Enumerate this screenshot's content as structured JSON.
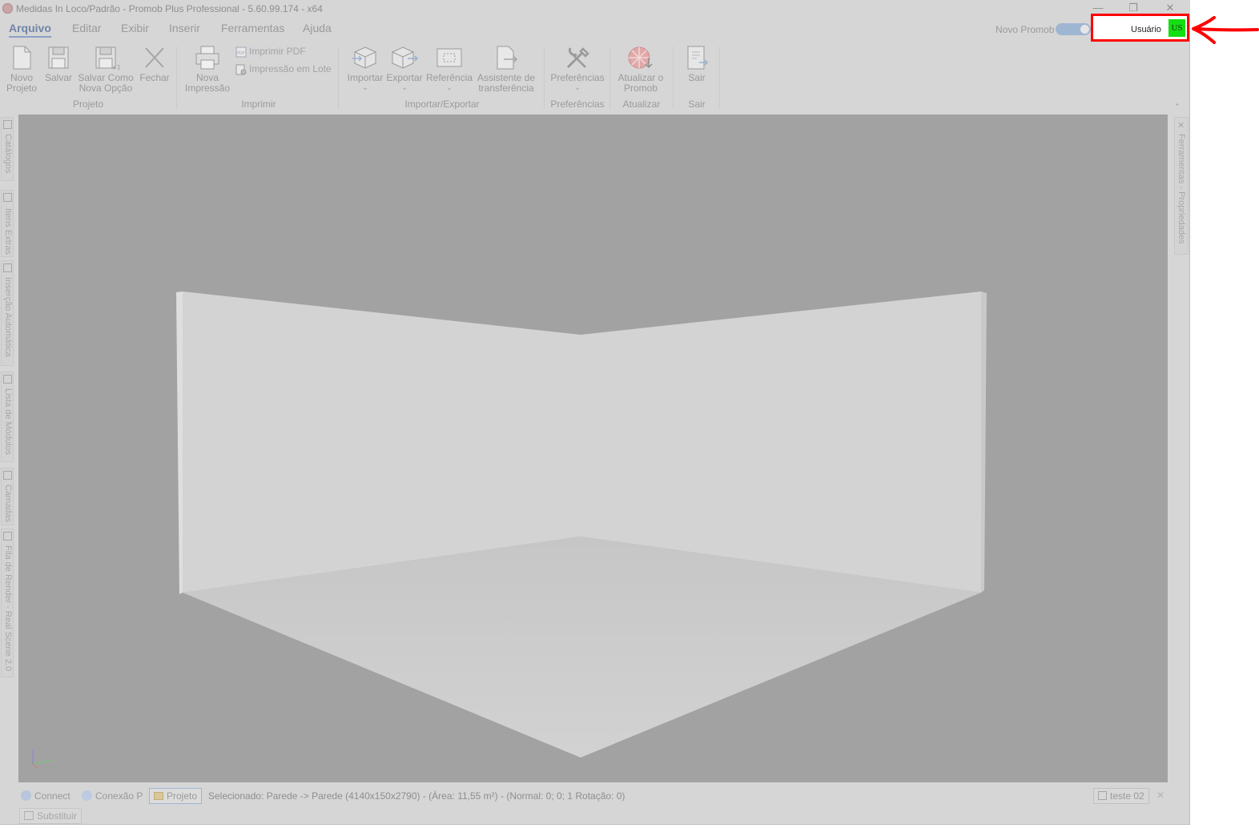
{
  "window": {
    "title": "Medidas In Loco/Padrão - Promob Plus Professional - 5.60.99.174 - x64",
    "minimize": "—",
    "restore": "❐",
    "close": "✕"
  },
  "menu": {
    "tabs": [
      {
        "label": "Arquivo",
        "active": true
      },
      {
        "label": "Editar"
      },
      {
        "label": "Exibir"
      },
      {
        "label": "Inserir"
      },
      {
        "label": "Ferramentas"
      },
      {
        "label": "Ajuda"
      }
    ]
  },
  "header": {
    "novo_promob": "Novo Promob",
    "user_label": "Usuário",
    "user_initials": "US"
  },
  "ribbon": {
    "novo_projeto": [
      "Novo",
      "Projeto"
    ],
    "salvar": "Salvar",
    "salvar_como": [
      "Salvar Como",
      "Nova Opção"
    ],
    "fechar": "Fechar",
    "nova_impressao": [
      "Nova",
      "Impressão"
    ],
    "imprimir_pdf": "Imprimir PDF",
    "impressao_lote": "Impressão em Lote",
    "importar": "Importar",
    "exportar": "Exportar",
    "referencia": "Referência",
    "assistente": [
      "Assistente de",
      "transferência"
    ],
    "preferencias": "Preferências",
    "atualizar": [
      "Atualizar o",
      "Promob"
    ],
    "sair": "Sair",
    "groups": {
      "projeto": "Projeto",
      "imprimir": "Imprimir",
      "importar_exportar": "Importar/Exportar",
      "preferencias": "Preferências",
      "atualizar": "Atualizar",
      "sair": "Sair"
    }
  },
  "left_tabs": [
    "Catálogos",
    "Itens Extras",
    "Inserção Automática",
    "Lista de Módulos",
    "Camadas",
    "Fila de Render - Real Scene 2.0"
  ],
  "right_tab": "Ferramentas - Propriedades",
  "status": {
    "connect": "Connect",
    "conexao": "Conexão P",
    "projeto": "Projeto",
    "selection": "Selecionado: Parede -> Parede (4140x150x2790) - (Área: 11,55 m²) - (Normal: 0; 0; 1 Rotação: 0)",
    "doc_tab": "teste 02",
    "close": "✕",
    "substituir": "Substituir"
  },
  "colors": {
    "annotation": "#ff0000",
    "avatar": "#12e012",
    "accent": "#6f84a6"
  }
}
